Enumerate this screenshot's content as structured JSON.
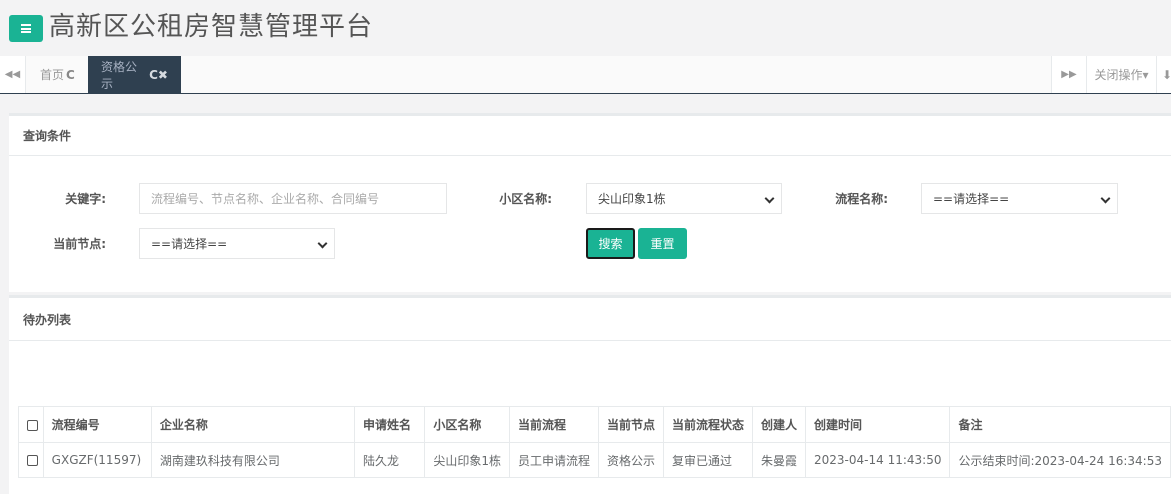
{
  "app": {
    "title": "高新区公租房智慧管理平台"
  },
  "tabs": [
    {
      "label": "首页",
      "icons": "C"
    },
    {
      "label": "资格公示",
      "icons": "C✖",
      "active": true
    }
  ],
  "toolbar": {
    "close_ops_label": "关闭操作▾"
  },
  "query": {
    "title": "查询条件",
    "keyword_label": "关键字:",
    "keyword_placeholder": "流程编号、节点名称、企业名称、合同编号",
    "community_label": "小区名称:",
    "community_value": "尖山印象1栋",
    "process_label": "流程名称:",
    "process_value": "==请选择==",
    "node_label": "当前节点:",
    "node_value": "==请选择==",
    "search_label": "搜索",
    "reset_label": "重置"
  },
  "list": {
    "title": "待办列表",
    "columns": [
      "流程编号",
      "企业名称",
      "申请姓名",
      "小区名称",
      "当前流程",
      "当前节点",
      "当前流程状态",
      "创建人",
      "创建时间",
      "备注"
    ],
    "rows": [
      [
        "GXGZF(11597)",
        "湖南建玖科技有限公司",
        "陆久龙",
        "尖山印象1栋",
        "员工申请流程",
        "资格公示",
        "复审已通过",
        "朱曼霞",
        "2023-04-14 11:43:50",
        "公示结束时间:2023-04-24 16:34:53"
      ]
    ]
  },
  "colors": {
    "accent": "#1ab394",
    "nav_dark": "#2f4050"
  }
}
